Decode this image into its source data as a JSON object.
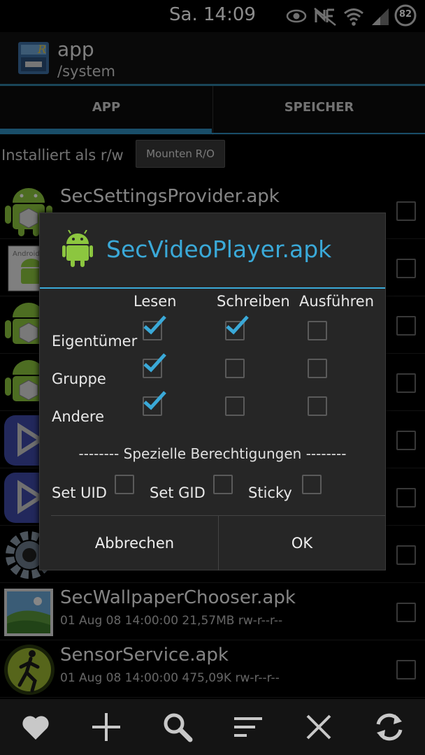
{
  "statusbar": {
    "time": "Sa. 14:09",
    "battery": "82",
    "icons": [
      "eye-icon",
      "nfc-icon",
      "wifi-icon",
      "signal-icon",
      "battery-icon"
    ]
  },
  "actionbar": {
    "title": "app",
    "subtitle": "/system"
  },
  "tabs": [
    {
      "label": "APP"
    },
    {
      "label": "SPEICHER"
    }
  ],
  "mount": {
    "label": "Installiert als r/w",
    "button": "Mounten R/O"
  },
  "list": {
    "items": [
      {
        "name": "SecSettingsProvider.apk",
        "meta": "",
        "icon": "android-icon"
      },
      {
        "name": "",
        "meta": "",
        "icon": "android-settings-icon"
      },
      {
        "name": "",
        "meta": "",
        "icon": "android-icon"
      },
      {
        "name": "",
        "meta": "",
        "icon": "android-icon"
      },
      {
        "name": "",
        "meta": "",
        "icon": "video-player-icon"
      },
      {
        "name": "",
        "meta": "",
        "icon": "video-player-icon"
      },
      {
        "name": "",
        "meta": "",
        "icon": "gear-icon"
      },
      {
        "name": "SecWallpaperChooser.apk",
        "meta": "01 Aug 08 14:00:00  21,57MB  rw-r--r--",
        "icon": "wallpaper-icon"
      },
      {
        "name": "SensorService.apk",
        "meta": "01 Aug 08 14:00:00  475,09K  rw-r--r--",
        "icon": "runner-icon"
      }
    ]
  },
  "dialog": {
    "title": "SecVideoPlayer.apk",
    "columns": [
      "Lesen",
      "Schreiben",
      "Ausführen"
    ],
    "rows": [
      {
        "label": "Eigentümer",
        "read": true,
        "write": true,
        "exec": false
      },
      {
        "label": "Gruppe",
        "read": true,
        "write": false,
        "exec": false
      },
      {
        "label": "Andere",
        "read": true,
        "write": false,
        "exec": false
      }
    ],
    "special_title": "-------- Spezielle Berechtigungen --------",
    "special": [
      {
        "label": "Set UID",
        "checked": false
      },
      {
        "label": "Set GID",
        "checked": false
      },
      {
        "label": "Sticky",
        "checked": false
      }
    ],
    "cancel": "Abbrechen",
    "ok": "OK"
  },
  "bottombar": {
    "icons": [
      "heart-icon",
      "plus-icon",
      "search-icon",
      "sort-icon",
      "close-icon",
      "refresh-icon"
    ]
  },
  "colors": {
    "accent": "#3aa9d8",
    "tab_indicator": "#2f8fbf",
    "android_green": "#8cc63f"
  }
}
